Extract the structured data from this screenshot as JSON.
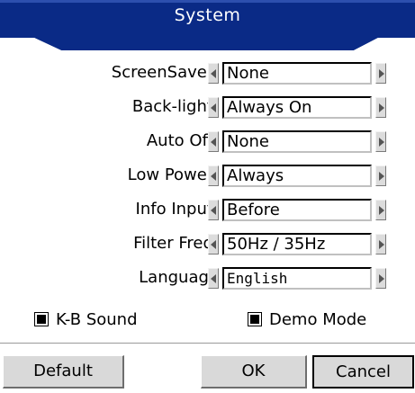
{
  "window": {
    "title": "System",
    "title_bar_color": "#0a2a86"
  },
  "settings": [
    {
      "label": "ScreenSaver:",
      "value": "None"
    },
    {
      "label": "Back-light:",
      "value": "Always On"
    },
    {
      "label": "Auto Off:",
      "value": "None"
    },
    {
      "label": "Low Power:",
      "value": "Always"
    },
    {
      "label": "Info Input:",
      "value": "Before"
    },
    {
      "label": "Filter Freq:",
      "value": "50Hz / 35Hz"
    },
    {
      "label": "Language",
      "value": "English"
    }
  ],
  "checkboxes": {
    "kb_sound": {
      "label": "K-B Sound",
      "checked": true
    },
    "demo_mode": {
      "label": "Demo Mode",
      "checked": true
    }
  },
  "buttons": {
    "default_label": "Default",
    "ok_label": "OK",
    "cancel_label": "Cancel"
  },
  "icons": {
    "left_arrow": "arrow-left-icon",
    "right_arrow": "arrow-right-icon",
    "checkbox": "checkbox-checked-icon"
  }
}
